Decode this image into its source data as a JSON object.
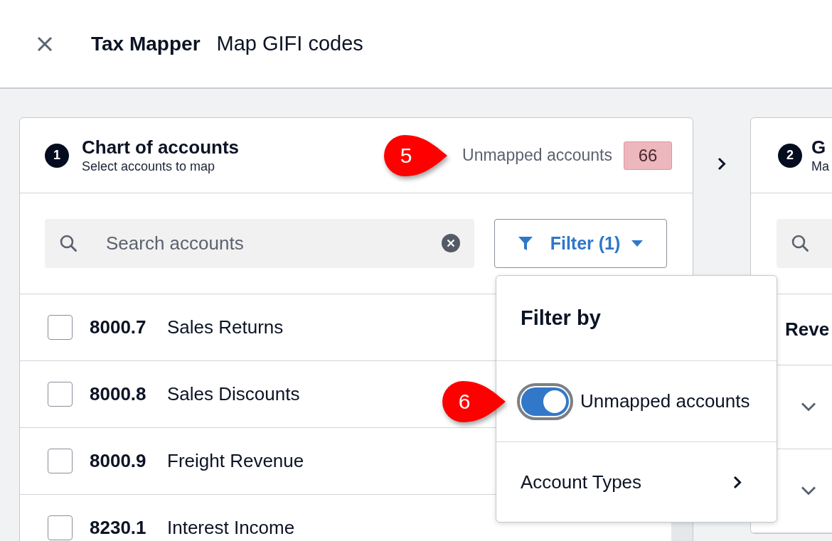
{
  "header": {
    "title": "Tax Mapper",
    "subtitle": "Map GIFI codes"
  },
  "accounts_panel": {
    "step": "1",
    "title": "Chart of accounts",
    "subtitle": "Select accounts to map",
    "counter": {
      "label": "Unmapped accounts",
      "count": "66",
      "callout": "5"
    },
    "search": {
      "placeholder": "Search accounts"
    },
    "filter_button": {
      "label": "Filter (1)"
    },
    "rows": [
      {
        "code": "8000.7",
        "name": "Sales Returns",
        "checked": false
      },
      {
        "code": "8000.8",
        "name": "Sales Discounts",
        "checked": false
      },
      {
        "code": "8000.9",
        "name": "Freight Revenue",
        "checked": false
      },
      {
        "code": "8230.1",
        "name": "Interest Income",
        "checked": false
      }
    ]
  },
  "filter_popup": {
    "title": "Filter by",
    "toggle": {
      "label": "Unmapped accounts",
      "on": true,
      "focused": true,
      "callout": "6"
    },
    "items": [
      {
        "label": "Account Types"
      }
    ]
  },
  "next_panel": {
    "step": "2",
    "title": "G",
    "subtitle": "Ma",
    "group_header": "Reve",
    "groups": [
      {
        "expanded": false
      },
      {
        "expanded": false
      }
    ]
  }
}
